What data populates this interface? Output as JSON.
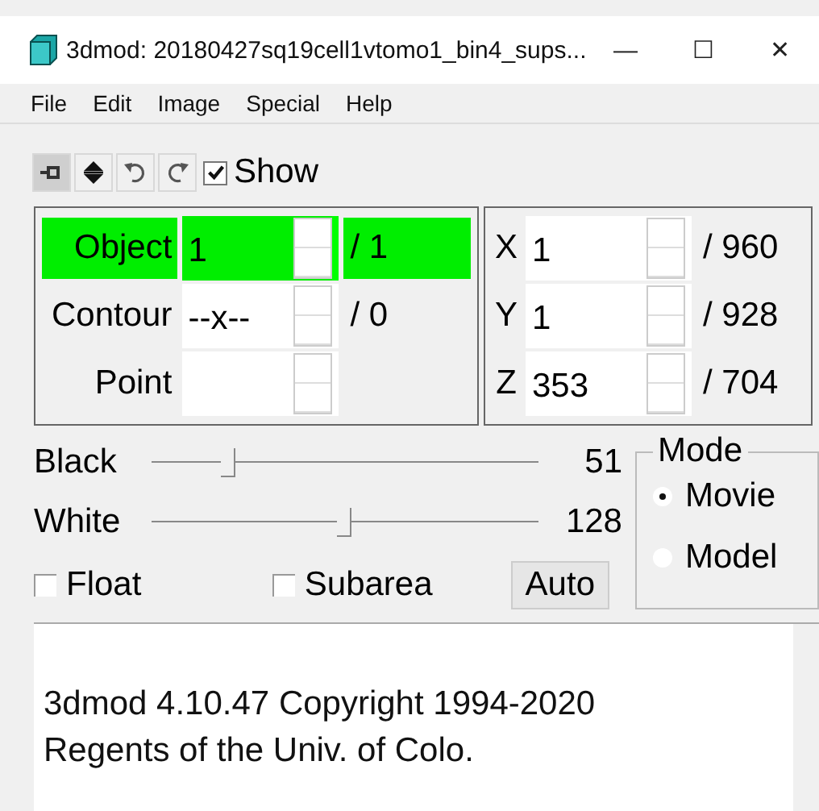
{
  "window": {
    "title": "3dmod: 20180427sq19cell1vtomo1_bin4_sups...",
    "controls": [
      "—",
      "☐",
      "✕"
    ]
  },
  "menu": [
    "File",
    "Edit",
    "Image",
    "Special",
    "Help"
  ],
  "toolbar": {
    "show": {
      "label": "Show",
      "checked": true
    }
  },
  "object_panel": [
    {
      "label": "Object",
      "value": "1",
      "max": "/ 1",
      "highlighted": true
    },
    {
      "label": "Contour",
      "value": "--x--",
      "max": "/ 0",
      "highlighted": false
    },
    {
      "label": "Point",
      "highlighted": false
    }
  ],
  "coords": [
    {
      "axis": "X",
      "value": "1",
      "max": "/ 960"
    },
    {
      "axis": "Y",
      "value": "1",
      "max": "/ 928"
    },
    {
      "axis": "Z",
      "value": "353",
      "max": "/ 704"
    }
  ],
  "sliders": [
    {
      "label": "Black",
      "level": 0.2,
      "reading": "51"
    },
    {
      "label": "White",
      "level": 0.5,
      "reading": "128"
    }
  ],
  "options": [
    {
      "label": "Float",
      "checked": false
    },
    {
      "label": "Subarea",
      "checked": false
    }
  ],
  "auto_button": "Auto",
  "mode": {
    "title": "Mode",
    "options": [
      {
        "label": "Movie",
        "selected": true
      },
      {
        "label": "Model",
        "selected": false
      }
    ]
  },
  "info_lines": [
    "3dmod 4.10.47 Copyright 1994-2020",
    "Regents of the Univ. of Colo."
  ]
}
